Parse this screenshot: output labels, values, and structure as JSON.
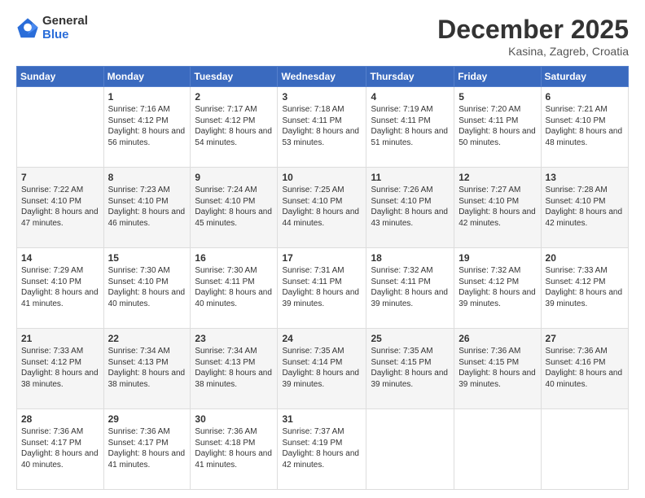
{
  "header": {
    "logo_general": "General",
    "logo_blue": "Blue",
    "month_title": "December 2025",
    "location": "Kasina, Zagreb, Croatia"
  },
  "columns": [
    "Sunday",
    "Monday",
    "Tuesday",
    "Wednesday",
    "Thursday",
    "Friday",
    "Saturday"
  ],
  "weeks": [
    [
      {
        "day": "",
        "sunrise": "",
        "sunset": "",
        "daylight": ""
      },
      {
        "day": "1",
        "sunrise": "7:16 AM",
        "sunset": "4:12 PM",
        "daylight": "8 hours and 56 minutes."
      },
      {
        "day": "2",
        "sunrise": "7:17 AM",
        "sunset": "4:12 PM",
        "daylight": "8 hours and 54 minutes."
      },
      {
        "day": "3",
        "sunrise": "7:18 AM",
        "sunset": "4:11 PM",
        "daylight": "8 hours and 53 minutes."
      },
      {
        "day": "4",
        "sunrise": "7:19 AM",
        "sunset": "4:11 PM",
        "daylight": "8 hours and 51 minutes."
      },
      {
        "day": "5",
        "sunrise": "7:20 AM",
        "sunset": "4:11 PM",
        "daylight": "8 hours and 50 minutes."
      },
      {
        "day": "6",
        "sunrise": "7:21 AM",
        "sunset": "4:10 PM",
        "daylight": "8 hours and 48 minutes."
      }
    ],
    [
      {
        "day": "7",
        "sunrise": "7:22 AM",
        "sunset": "4:10 PM",
        "daylight": "8 hours and 47 minutes."
      },
      {
        "day": "8",
        "sunrise": "7:23 AM",
        "sunset": "4:10 PM",
        "daylight": "8 hours and 46 minutes."
      },
      {
        "day": "9",
        "sunrise": "7:24 AM",
        "sunset": "4:10 PM",
        "daylight": "8 hours and 45 minutes."
      },
      {
        "day": "10",
        "sunrise": "7:25 AM",
        "sunset": "4:10 PM",
        "daylight": "8 hours and 44 minutes."
      },
      {
        "day": "11",
        "sunrise": "7:26 AM",
        "sunset": "4:10 PM",
        "daylight": "8 hours and 43 minutes."
      },
      {
        "day": "12",
        "sunrise": "7:27 AM",
        "sunset": "4:10 PM",
        "daylight": "8 hours and 42 minutes."
      },
      {
        "day": "13",
        "sunrise": "7:28 AM",
        "sunset": "4:10 PM",
        "daylight": "8 hours and 42 minutes."
      }
    ],
    [
      {
        "day": "14",
        "sunrise": "7:29 AM",
        "sunset": "4:10 PM",
        "daylight": "8 hours and 41 minutes."
      },
      {
        "day": "15",
        "sunrise": "7:30 AM",
        "sunset": "4:10 PM",
        "daylight": "8 hours and 40 minutes."
      },
      {
        "day": "16",
        "sunrise": "7:30 AM",
        "sunset": "4:11 PM",
        "daylight": "8 hours and 40 minutes."
      },
      {
        "day": "17",
        "sunrise": "7:31 AM",
        "sunset": "4:11 PM",
        "daylight": "8 hours and 39 minutes."
      },
      {
        "day": "18",
        "sunrise": "7:32 AM",
        "sunset": "4:11 PM",
        "daylight": "8 hours and 39 minutes."
      },
      {
        "day": "19",
        "sunrise": "7:32 AM",
        "sunset": "4:12 PM",
        "daylight": "8 hours and 39 minutes."
      },
      {
        "day": "20",
        "sunrise": "7:33 AM",
        "sunset": "4:12 PM",
        "daylight": "8 hours and 39 minutes."
      }
    ],
    [
      {
        "day": "21",
        "sunrise": "7:33 AM",
        "sunset": "4:12 PM",
        "daylight": "8 hours and 38 minutes."
      },
      {
        "day": "22",
        "sunrise": "7:34 AM",
        "sunset": "4:13 PM",
        "daylight": "8 hours and 38 minutes."
      },
      {
        "day": "23",
        "sunrise": "7:34 AM",
        "sunset": "4:13 PM",
        "daylight": "8 hours and 38 minutes."
      },
      {
        "day": "24",
        "sunrise": "7:35 AM",
        "sunset": "4:14 PM",
        "daylight": "8 hours and 39 minutes."
      },
      {
        "day": "25",
        "sunrise": "7:35 AM",
        "sunset": "4:15 PM",
        "daylight": "8 hours and 39 minutes."
      },
      {
        "day": "26",
        "sunrise": "7:36 AM",
        "sunset": "4:15 PM",
        "daylight": "8 hours and 39 minutes."
      },
      {
        "day": "27",
        "sunrise": "7:36 AM",
        "sunset": "4:16 PM",
        "daylight": "8 hours and 40 minutes."
      }
    ],
    [
      {
        "day": "28",
        "sunrise": "7:36 AM",
        "sunset": "4:17 PM",
        "daylight": "8 hours and 40 minutes."
      },
      {
        "day": "29",
        "sunrise": "7:36 AM",
        "sunset": "4:17 PM",
        "daylight": "8 hours and 41 minutes."
      },
      {
        "day": "30",
        "sunrise": "7:36 AM",
        "sunset": "4:18 PM",
        "daylight": "8 hours and 41 minutes."
      },
      {
        "day": "31",
        "sunrise": "7:37 AM",
        "sunset": "4:19 PM",
        "daylight": "8 hours and 42 minutes."
      },
      {
        "day": "",
        "sunrise": "",
        "sunset": "",
        "daylight": ""
      },
      {
        "day": "",
        "sunrise": "",
        "sunset": "",
        "daylight": ""
      },
      {
        "day": "",
        "sunrise": "",
        "sunset": "",
        "daylight": ""
      }
    ]
  ]
}
